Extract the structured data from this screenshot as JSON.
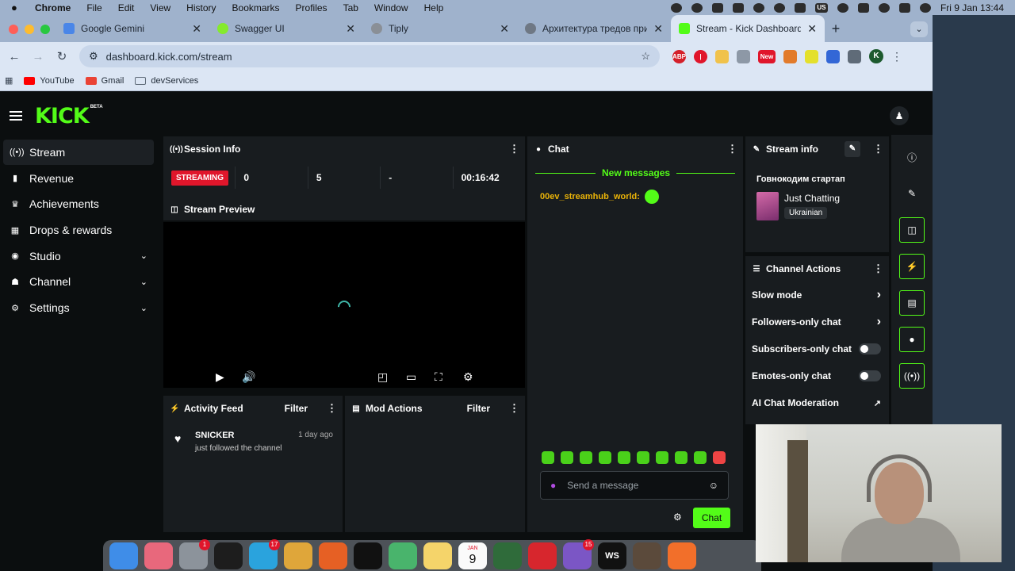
{
  "menubar": {
    "app": "Chrome",
    "items": [
      "File",
      "Edit",
      "View",
      "History",
      "Bookmarks",
      "Profiles",
      "Tab",
      "Window",
      "Help"
    ],
    "clock": "Fri 9 Jan  13:44"
  },
  "tabs": [
    {
      "title": "Google Gemini",
      "color": "#4a86e8"
    },
    {
      "title": "Swagger UI",
      "color": "#85ea2d"
    },
    {
      "title": "Tiply",
      "color": "#8a8f96"
    },
    {
      "title": "Архитектура тредов прилож",
      "color": "#6f7884"
    },
    {
      "title": "Stream - Kick Dashboard",
      "color": "#53fc18"
    }
  ],
  "address": {
    "url": "dashboard.kick.com/stream"
  },
  "bookmarks": [
    {
      "label": "YouTube",
      "color": "#ff0000"
    },
    {
      "label": "Gmail",
      "color": "#ea4335"
    },
    {
      "label": "devServices",
      "color": "#5f6b78"
    }
  ],
  "kick": {
    "logo": "KICK",
    "beta": "BETA",
    "sidebar": [
      {
        "label": "Stream",
        "icon": "broadcast-icon",
        "glyph": "((•))",
        "chevron": false
      },
      {
        "label": "Revenue",
        "icon": "chart-icon",
        "glyph": "▮",
        "chevron": false
      },
      {
        "label": "Achievements",
        "icon": "trophy-icon",
        "glyph": "🏆",
        "chevron": false
      },
      {
        "label": "Drops & rewards",
        "icon": "gift-icon",
        "glyph": "▦",
        "chevron": false
      },
      {
        "label": "Studio",
        "icon": "studio-icon",
        "glyph": "◉",
        "chevron": true
      },
      {
        "label": "Channel",
        "icon": "channel-icon",
        "glyph": "☗",
        "chevron": true
      },
      {
        "label": "Settings",
        "icon": "gear-icon",
        "glyph": "⚙",
        "chevron": true
      }
    ],
    "session": {
      "title": "Session Info",
      "badge": "STREAMING",
      "stats": [
        "0",
        "5",
        "-",
        "00:16:42"
      ]
    },
    "preview": {
      "title": "Stream Preview"
    },
    "activity": {
      "title": "Activity Feed",
      "filter": "Filter",
      "item": {
        "name": "SNICKER",
        "text": "just followed the channel",
        "time": "1 day ago"
      }
    },
    "mod": {
      "title": "Mod Actions",
      "filter": "Filter"
    },
    "chat": {
      "title": "Chat",
      "new_messages": "New messages",
      "message_user": "00ev_streamhub_world:",
      "placeholder": "Send a message",
      "send": "Chat"
    },
    "stream_info": {
      "title": "Stream info",
      "stream_title": "Говнокодим стартап",
      "category": "Just Chatting",
      "tag": "Ukrainian"
    },
    "channel_actions": {
      "title": "Channel Actions",
      "items": [
        {
          "label": "Slow mode",
          "kind": "arrow"
        },
        {
          "label": "Followers-only chat",
          "kind": "arrow"
        },
        {
          "label": "Subscribers-only chat",
          "kind": "toggle"
        },
        {
          "label": "Emotes-only chat",
          "kind": "toggle"
        },
        {
          "label": "AI Chat Moderation",
          "kind": "link"
        }
      ]
    }
  },
  "dock_badges": {
    "settings": "1",
    "telegram": "17",
    "viber": "15"
  },
  "dock_calendar": {
    "month": "JAN",
    "day": "9"
  },
  "accent": "#53fc18"
}
